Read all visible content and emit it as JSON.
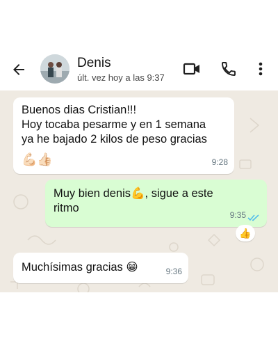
{
  "header": {
    "contact_name": "Denis",
    "last_seen": "últ. vez hoy a las 9:37",
    "icons": [
      "back-arrow-icon",
      "video-call-icon",
      "phone-icon",
      "more-options-icon"
    ]
  },
  "messages": [
    {
      "direction": "incoming",
      "text_lines": [
        "Buenos dias Cristian!!!",
        "Hoy tocaba pesarme y en 1 semana",
        "ya he bajado 2 kilos de peso gracias"
      ],
      "emoji": "💪🏻👍🏻",
      "time": "9:28"
    },
    {
      "direction": "outgoing",
      "text_lines": [
        "Muy bien denis💪, sigue a este",
        "ritmo"
      ],
      "time": "9:35",
      "read_status": "double-check-blue",
      "reaction": "👍"
    },
    {
      "direction": "incoming",
      "text": "Muchísimas gracias 😁",
      "time": "9:36"
    }
  ],
  "colors": {
    "chat_background": "#efeae2",
    "incoming_bubble": "#ffffff",
    "outgoing_bubble": "#d9fdd3",
    "read_ticks": "#53bdeb",
    "timestamp": "#667781"
  }
}
